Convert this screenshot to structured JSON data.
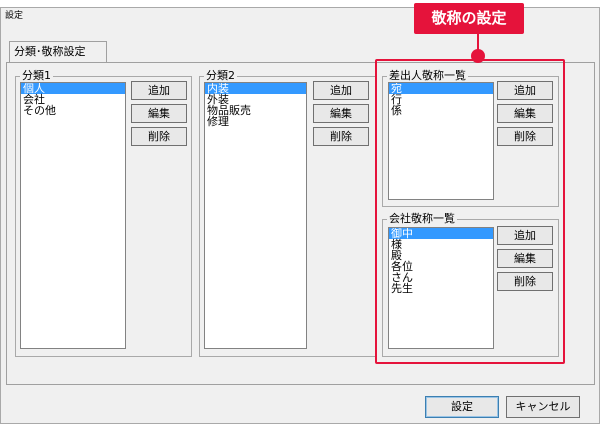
{
  "window": {
    "title": "設定"
  },
  "tab": {
    "label": "分類･敬称設定"
  },
  "groups": {
    "g1": {
      "title": "分類1",
      "items": [
        "個人",
        "会社",
        "その他"
      ],
      "selected": 0,
      "buttons": {
        "add": "追加",
        "edit": "編集",
        "delete": "削除"
      }
    },
    "g2": {
      "title": "分類2",
      "items": [
        "内装",
        "外装",
        "物品販売",
        "修理"
      ],
      "selected": 0,
      "buttons": {
        "add": "追加",
        "edit": "編集",
        "delete": "削除"
      }
    },
    "g3": {
      "title": "差出人敬称一覧",
      "items": [
        "宛",
        "行",
        "係"
      ],
      "selected": 0,
      "buttons": {
        "add": "追加",
        "edit": "編集",
        "delete": "削除"
      }
    },
    "g4": {
      "title": "会社敬称一覧",
      "items": [
        "御中",
        "様",
        "殿",
        "各位",
        "さん",
        "先生"
      ],
      "selected": 0,
      "buttons": {
        "add": "追加",
        "edit": "編集",
        "delete": "削除"
      }
    }
  },
  "footer": {
    "ok": "設定",
    "cancel": "キャンセル"
  },
  "callout": {
    "label": "敬称の設定",
    "color": "#e5133b"
  }
}
